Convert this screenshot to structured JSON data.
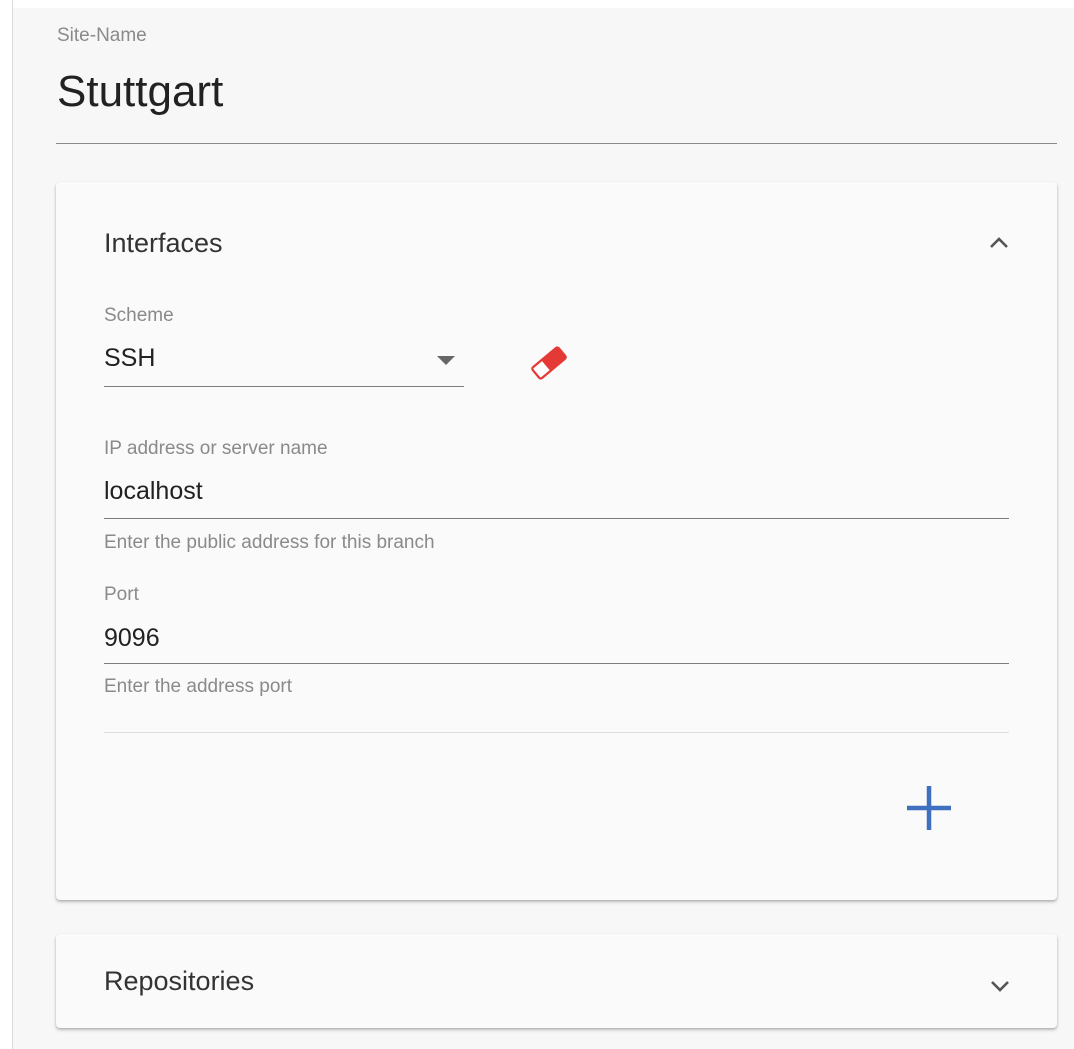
{
  "site": {
    "label": "Site-Name",
    "value": "Stuttgart"
  },
  "interfaces": {
    "title": "Interfaces",
    "expanded": true,
    "scheme": {
      "label": "Scheme",
      "value": "SSH"
    },
    "address": {
      "label": "IP address or server name",
      "value": "localhost",
      "hint": "Enter the public address for this branch"
    },
    "port": {
      "label": "Port",
      "value": "9096",
      "hint": "Enter the address port"
    }
  },
  "repositories": {
    "title": "Repositories",
    "expanded": false
  },
  "colors": {
    "clear_icon": "#e53935",
    "add_icon": "#3f6fbf",
    "panel_bg": "#fafafa",
    "content_bg": "#f7f7f7"
  },
  "icons": {
    "sidebar_toggle": "chevron-right-icon",
    "interfaces_toggle": "chevron-up-icon",
    "repositories_toggle": "chevron-down-icon",
    "scheme_dropdown": "caret-down-icon",
    "clear": "eraser-icon",
    "add": "plus-icon"
  }
}
